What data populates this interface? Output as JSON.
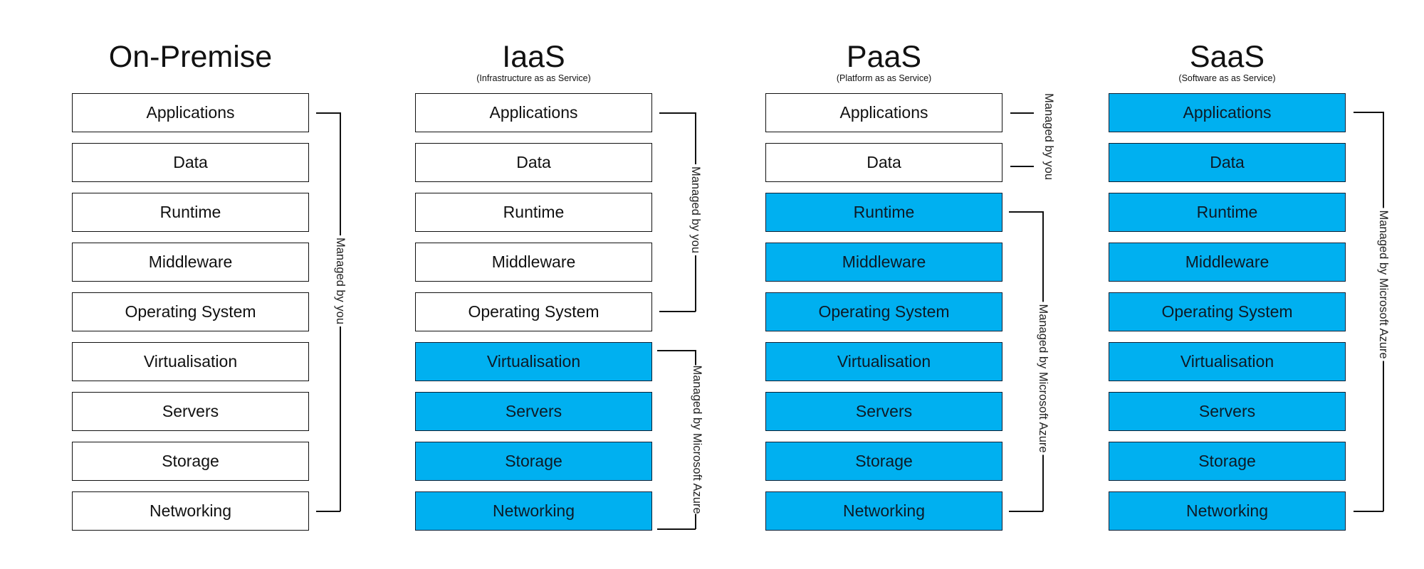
{
  "colors": {
    "managed_by_provider": "#00b0f0",
    "managed_by_you": "#ffffff"
  },
  "layers_order": [
    "Applications",
    "Data",
    "Runtime",
    "Middleware",
    "Operating System",
    "Virtualisation",
    "Servers",
    "Storage",
    "Networking"
  ],
  "columns": [
    {
      "title": "On-Premise",
      "subtitle": "",
      "layers": [
        {
          "label": "Applications",
          "managed_by": "you"
        },
        {
          "label": "Data",
          "managed_by": "you"
        },
        {
          "label": "Runtime",
          "managed_by": "you"
        },
        {
          "label": "Middleware",
          "managed_by": "you"
        },
        {
          "label": "Operating System",
          "managed_by": "you"
        },
        {
          "label": "Virtualisation",
          "managed_by": "you"
        },
        {
          "label": "Servers",
          "managed_by": "you"
        },
        {
          "label": "Storage",
          "managed_by": "you"
        },
        {
          "label": "Networking",
          "managed_by": "you"
        }
      ],
      "brackets": [
        {
          "label": "Managed by you",
          "from": "Applications",
          "to": "Networking"
        }
      ]
    },
    {
      "title": "IaaS",
      "subtitle": "(Infrastructure as as Service)",
      "layers": [
        {
          "label": "Applications",
          "managed_by": "you"
        },
        {
          "label": "Data",
          "managed_by": "you"
        },
        {
          "label": "Runtime",
          "managed_by": "you"
        },
        {
          "label": "Middleware",
          "managed_by": "you"
        },
        {
          "label": "Operating System",
          "managed_by": "you"
        },
        {
          "label": "Virtualisation",
          "managed_by": "Microsoft Azure"
        },
        {
          "label": "Servers",
          "managed_by": "Microsoft Azure"
        },
        {
          "label": "Storage",
          "managed_by": "Microsoft Azure"
        },
        {
          "label": "Networking",
          "managed_by": "Microsoft Azure"
        }
      ],
      "brackets": [
        {
          "label": "Managed by you",
          "from": "Applications",
          "to": "Operating System"
        },
        {
          "label": "Managed by Microsoft Azure",
          "from": "Virtualisation",
          "to": "Networking"
        }
      ]
    },
    {
      "title": "PaaS",
      "subtitle": "(Platform as as Service)",
      "layers": [
        {
          "label": "Applications",
          "managed_by": "you"
        },
        {
          "label": "Data",
          "managed_by": "you"
        },
        {
          "label": "Runtime",
          "managed_by": "Microsoft Azure"
        },
        {
          "label": "Middleware",
          "managed_by": "Microsoft Azure"
        },
        {
          "label": "Operating System",
          "managed_by": "Microsoft Azure"
        },
        {
          "label": "Virtualisation",
          "managed_by": "Microsoft Azure"
        },
        {
          "label": "Servers",
          "managed_by": "Microsoft Azure"
        },
        {
          "label": "Storage",
          "managed_by": "Microsoft Azure"
        },
        {
          "label": "Networking",
          "managed_by": "Microsoft Azure"
        }
      ],
      "brackets": [
        {
          "label": "Managed by you",
          "from": "Applications",
          "to": "Data"
        },
        {
          "label": "Managed by Microsoft Azure",
          "from": "Runtime",
          "to": "Networking"
        }
      ]
    },
    {
      "title": "SaaS",
      "subtitle": "(Software as as Service)",
      "layers": [
        {
          "label": "Applications",
          "managed_by": "Microsoft Azure"
        },
        {
          "label": "Data",
          "managed_by": "Microsoft Azure"
        },
        {
          "label": "Runtime",
          "managed_by": "Microsoft Azure"
        },
        {
          "label": "Middleware",
          "managed_by": "Microsoft Azure"
        },
        {
          "label": "Operating System",
          "managed_by": "Microsoft Azure"
        },
        {
          "label": "Virtualisation",
          "managed_by": "Microsoft Azure"
        },
        {
          "label": "Servers",
          "managed_by": "Microsoft Azure"
        },
        {
          "label": "Storage",
          "managed_by": "Microsoft Azure"
        },
        {
          "label": "Networking",
          "managed_by": "Microsoft Azure"
        }
      ],
      "brackets": [
        {
          "label": "Managed by Microsoft Azure",
          "from": "Applications",
          "to": "Networking"
        }
      ]
    }
  ]
}
